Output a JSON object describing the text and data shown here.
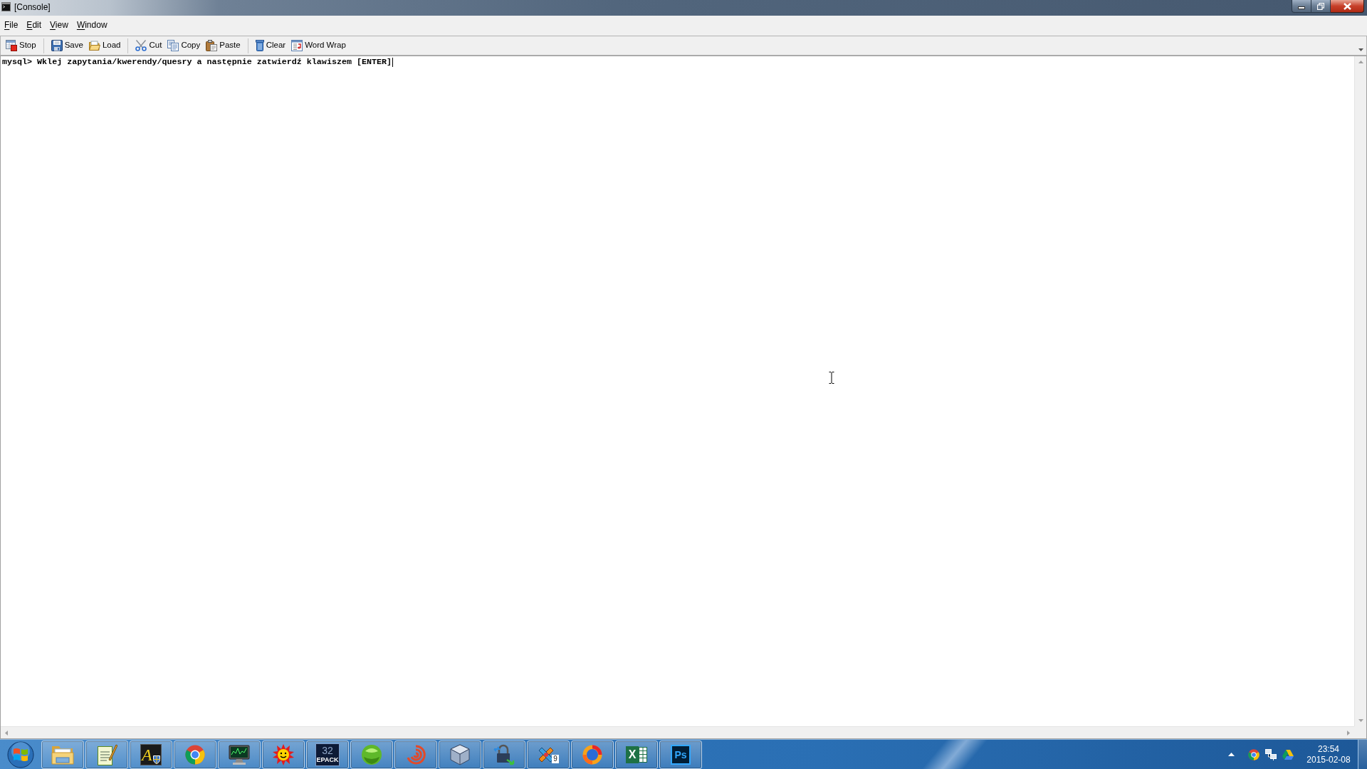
{
  "window": {
    "title": "[Console]",
    "controls": [
      {
        "kind": "minimize"
      },
      {
        "kind": "restore"
      },
      {
        "kind": "close"
      }
    ]
  },
  "menu": [
    {
      "label": "File"
    },
    {
      "label": "Edit"
    },
    {
      "label": "View"
    },
    {
      "label": "Window"
    }
  ],
  "toolbar": {
    "groups": [
      {
        "buttons": [
          {
            "kind": "stop",
            "label": "Stop"
          }
        ]
      },
      {
        "buttons": [
          {
            "kind": "save",
            "label": "Save"
          },
          {
            "kind": "load",
            "label": "Load"
          }
        ]
      },
      {
        "buttons": [
          {
            "kind": "cut",
            "label": "Cut"
          },
          {
            "kind": "copy",
            "label": "Copy"
          },
          {
            "kind": "paste",
            "label": "Paste"
          }
        ]
      },
      {
        "buttons": [
          {
            "kind": "clear",
            "label": "Clear"
          },
          {
            "kind": "wrap",
            "label": "Word Wrap"
          }
        ]
      }
    ]
  },
  "console": {
    "lines": [
      "mysql> Wklej zapytania/kwerendy/quesry a następnie zatwierdź klawiszem [ENTER]"
    ]
  },
  "taskbar": {
    "apps": [
      {
        "kind": "folder"
      },
      {
        "kind": "notepad"
      },
      {
        "kind": "letter",
        "label": "A"
      },
      {
        "kind": "ring"
      },
      {
        "kind": "monitor"
      },
      {
        "kind": "sun"
      },
      {
        "kind": "epack",
        "label": "32",
        "sublabel": "EPACK"
      },
      {
        "kind": "orb"
      },
      {
        "kind": "swirl"
      },
      {
        "kind": "cube"
      },
      {
        "kind": "lock"
      },
      {
        "kind": "tools",
        "badge": "9"
      },
      {
        "kind": "flame"
      },
      {
        "kind": "sheet",
        "label": "X"
      },
      {
        "kind": "ps",
        "label": "Ps"
      }
    ],
    "tray": [
      {
        "kind": "chevron"
      },
      {
        "kind": "ring"
      },
      {
        "kind": "network"
      },
      {
        "kind": "drive"
      }
    ],
    "clock": {
      "time": "23:54",
      "date": "2015-02-08"
    }
  }
}
